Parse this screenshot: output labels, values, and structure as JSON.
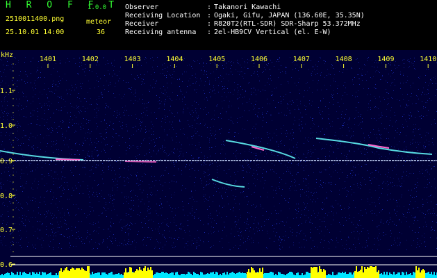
{
  "header": {
    "title": "H R O F F T",
    "version": "1.0.0",
    "filename": "2510011400.png",
    "datetime": "25.10.01 14:00",
    "meteor_label": "meteor",
    "meteor_count": "36",
    "fields": [
      {
        "label": "Observer",
        "sep": ":",
        "value": "Takanori Kawachi"
      },
      {
        "label": "Receiving Location",
        "sep": ":",
        "value": "Ogaki, Gifu, JAPAN (136.60E, 35.35N)"
      },
      {
        "label": "Receiver",
        "sep": ":",
        "value": "R820T2(RTL-SDR) SDR-Sharp 53.372MHz"
      },
      {
        "label": "Receiving antenna",
        "sep": ":",
        "value": "2el-HB9CV Vertical (el. E-W)"
      }
    ]
  },
  "spectrogram": {
    "y_unit": "kHz",
    "y_ticks": [
      "1.1",
      "1.0",
      "0.9",
      "0.8",
      "0.7",
      "0.6"
    ],
    "x_ticks": [
      "1401",
      "1402",
      "1403",
      "1404",
      "1405",
      "1406",
      "1407",
      "1408",
      "1409",
      "1410"
    ],
    "colors": {
      "background": "#000033",
      "noise": "#1a2ab0",
      "carrier": "#ccddff",
      "trace": "#66ffff",
      "trace_hot": "#ff66cc",
      "baseline": "#ffffff",
      "meteor_bar": "#ffff00",
      "noise_floor": "#00e5ff",
      "axis_text": "#ffff33"
    }
  }
}
